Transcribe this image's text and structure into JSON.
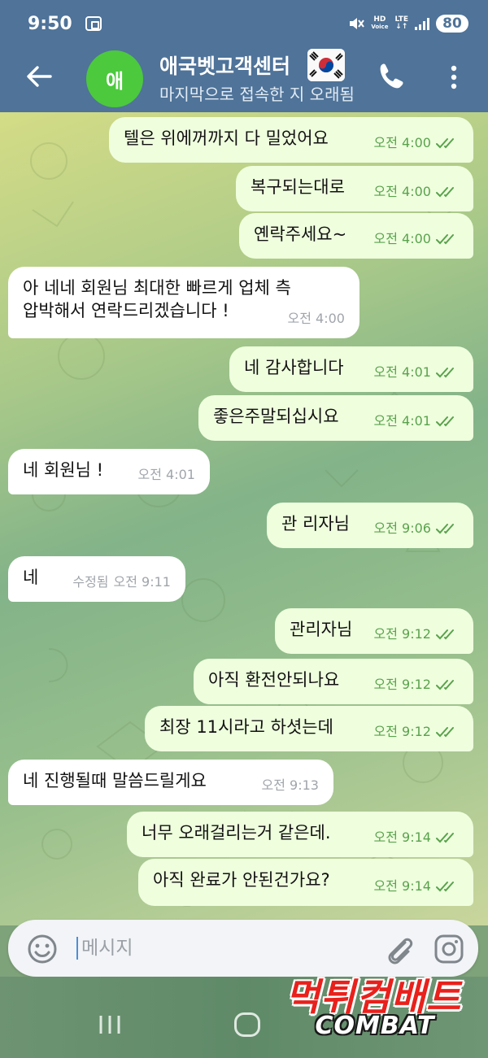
{
  "status_bar": {
    "time": "9:50",
    "hd_label": "HD",
    "voice_label": "Voice",
    "lte_label": "LTE",
    "battery": "80"
  },
  "header": {
    "avatar_letter": "애",
    "title": "애국벳고객센터",
    "subtitle": "마지막으로 접속한 지 오래됨"
  },
  "messages": [
    {
      "dir": "out",
      "text": "텔은 위에꺼까지 다 밀었어요",
      "edited": "",
      "time": "오전 4:00"
    },
    {
      "dir": "out",
      "text": "복구되는대로",
      "edited": "",
      "time": "오전 4:00"
    },
    {
      "dir": "out",
      "text": "옌락주세요~",
      "edited": "",
      "time": "오전 4:00"
    },
    {
      "dir": "in",
      "text": "아 네네 회원님 최대한 빠르게 업체 측",
      "text2": "압박해서 연락드리겠습니다 !",
      "edited": "",
      "time": "오전 4:00"
    },
    {
      "dir": "out",
      "text": "네 감사합니다",
      "edited": "",
      "time": "오전 4:01"
    },
    {
      "dir": "out",
      "text": "좋은주말되십시요",
      "edited": "",
      "time": "오전 4:01"
    },
    {
      "dir": "in",
      "text": "네 회원님 !",
      "edited": "",
      "time": "오전 4:01"
    },
    {
      "dir": "out",
      "text": "관 리자님",
      "edited": "",
      "time": "오전 9:06"
    },
    {
      "dir": "in",
      "text": "네",
      "edited": "수정됨",
      "time": "오전 9:11"
    },
    {
      "dir": "out",
      "text": "관리자님",
      "edited": "",
      "time": "오전 9:12"
    },
    {
      "dir": "out",
      "text": "아직 환전안되나요",
      "edited": "",
      "time": "오전 9:12"
    },
    {
      "dir": "out",
      "text": "최장 11시라고 하셧는데",
      "edited": "",
      "time": "오전 9:12"
    },
    {
      "dir": "in",
      "text": "네 진행될때 말씀드릴게요",
      "edited": "",
      "time": "오전 9:13"
    },
    {
      "dir": "out",
      "text": "너무 오래걸리는거 같은데.",
      "edited": "",
      "time": "오전 9:14"
    },
    {
      "dir": "out",
      "text": "아직 완료가 안된건가요?",
      "edited": "",
      "time": "오전 9:14"
    }
  ],
  "composer": {
    "placeholder": "메시지"
  },
  "watermark": {
    "top": "먹튀컴배트",
    "bottom": "COMBAT"
  },
  "colors": {
    "header_bg": "#4f7399",
    "outgoing_bubble": "#efffde",
    "incoming_bubble": "#ffffff",
    "outgoing_meta": "#59a24c",
    "avatar_bg": "#4cc93d",
    "watermark_red": "#e8211c"
  },
  "icons": {
    "status_rec": "screen-record-icon",
    "mute": "mute-icon",
    "signal": "signal-icon",
    "back": "back-arrow-icon",
    "flag": "korea-flag-icon",
    "call": "phone-icon",
    "menu": "more-vertical-icon",
    "read": "double-check-icon",
    "emoji": "emoji-icon",
    "attach": "paperclip-icon",
    "camera": "camera-icon"
  }
}
